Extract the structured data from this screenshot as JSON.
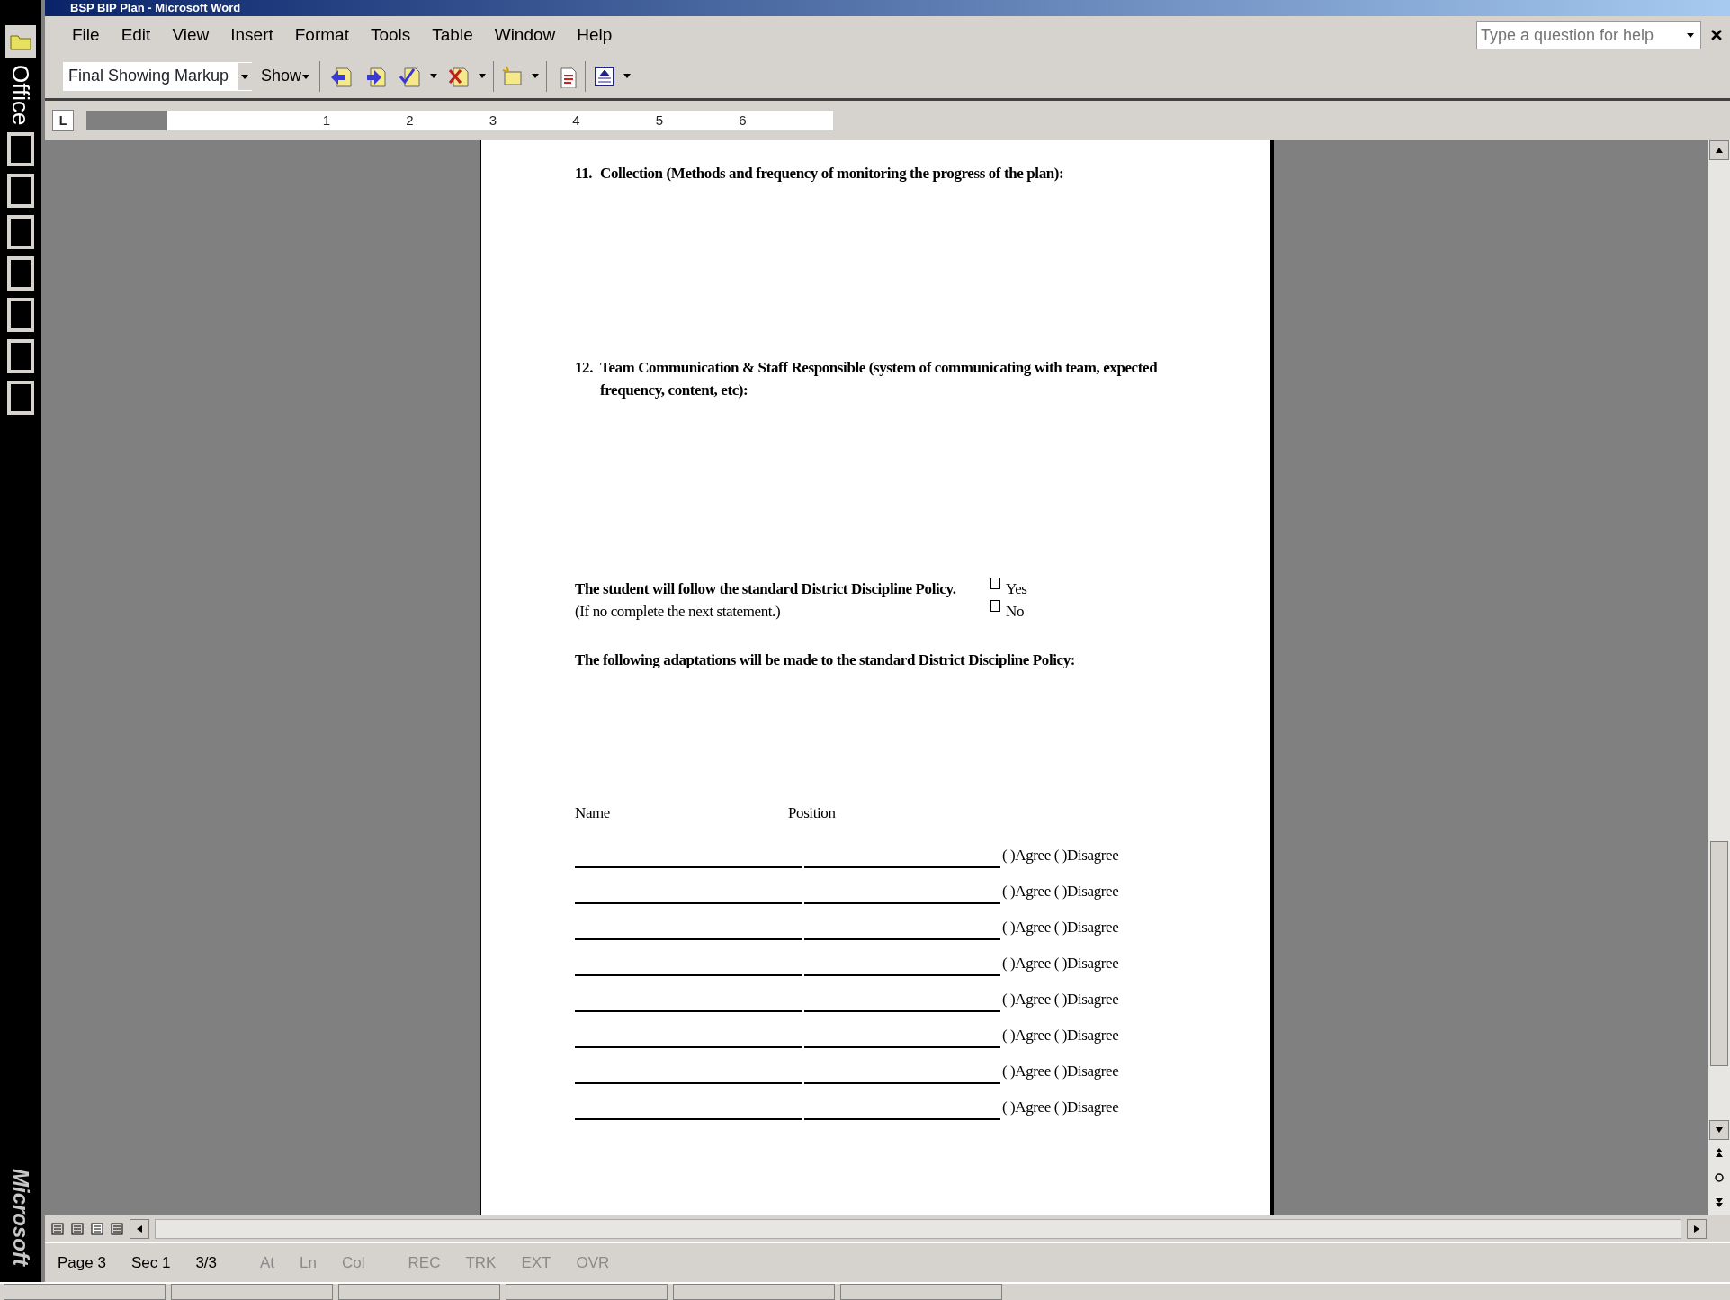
{
  "window": {
    "title": "BSP BIP Plan - Microsoft Word"
  },
  "office_bar": {
    "label": "Office",
    "brand": "Microsoft"
  },
  "menu": [
    "File",
    "Edit",
    "View",
    "Insert",
    "Format",
    "Tools",
    "Table",
    "Window",
    "Help"
  ],
  "help_box": {
    "placeholder": "Type a question for help"
  },
  "toolbar": {
    "display_mode": "Final Showing Markup",
    "show": "Show"
  },
  "ruler": {
    "tab_selector": "L",
    "numbers": [
      "1",
      "2",
      "3",
      "4",
      "5",
      "6"
    ]
  },
  "document": {
    "sections": [
      {
        "number": "11.",
        "text": "Collection (Methods and frequency of monitoring the progress of the plan):"
      },
      {
        "number": "12.",
        "text": "Team Communication & Staff Responsible (system of communicating with team, expected frequency, content, etc):"
      }
    ],
    "policy": {
      "statement": "The student will follow the standard District Discipline Policy.",
      "note": "(If no complete the next statement.)",
      "options": [
        {
          "label": "Yes",
          "checked": false
        },
        {
          "label": "No",
          "checked": false
        }
      ]
    },
    "adaptations": "The following adaptations will be made to the standard District Discipline Policy:",
    "signature_headers": [
      "Name",
      "Position"
    ],
    "signature_rows": [
      "( )Agree ( )Disagree",
      "( )Agree ( )Disagree",
      "( )Agree ( )Disagree",
      "( )Agree ( )Disagree",
      "( )Agree ( )Disagree",
      "( )Agree ( )Disagree",
      "( )Agree ( )Disagree",
      "( )Agree ( )Disagree"
    ]
  },
  "status_bar": [
    {
      "text": "Page 3",
      "disabled": false
    },
    {
      "text": "Sec 1",
      "disabled": false
    },
    {
      "text": "3/3",
      "disabled": false
    },
    {
      "text": "At",
      "disabled": true
    },
    {
      "text": "Ln",
      "disabled": true
    },
    {
      "text": "Col",
      "disabled": true
    },
    {
      "text": "REC",
      "disabled": true
    },
    {
      "text": "TRK",
      "disabled": true
    },
    {
      "text": "EXT",
      "disabled": true
    },
    {
      "text": "OVR",
      "disabled": true
    }
  ]
}
